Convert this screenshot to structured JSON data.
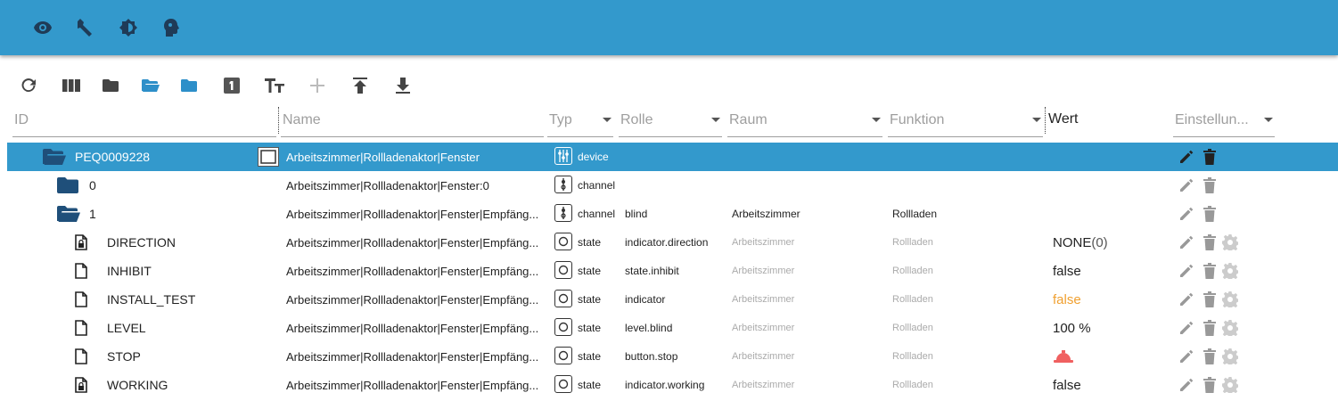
{
  "appbar": {
    "icons": [
      "eye-icon",
      "wrench-icon",
      "brightness-icon",
      "head-icon"
    ]
  },
  "toolbar": {
    "icons": [
      "refresh-icon",
      "columns-icon",
      "folder-closed-icon",
      "folder-open-icon",
      "folder-icon",
      "number-1-icon",
      "text-size-icon",
      "add-icon",
      "upload-icon",
      "download-icon"
    ]
  },
  "columns": {
    "id": "ID",
    "name": "Name",
    "type": "Typ",
    "role": "Rolle",
    "room": "Raum",
    "function": "Funktion",
    "value": "Wert",
    "settings": "Einstellun..."
  },
  "rows": [
    {
      "id": "PEQ0009228",
      "name": "Arbeitszimmer|Rollladenaktor|Fenster",
      "type": "device",
      "role": "",
      "room": "",
      "function": "",
      "value": "",
      "icon": "folder-open-icon"
    },
    {
      "id": "0",
      "name": "Arbeitszimmer|Rollladenaktor|Fenster:0",
      "type": "channel",
      "role": "",
      "room": "",
      "function": "",
      "value": "",
      "icon": "folder-icon"
    },
    {
      "id": "1",
      "name": "Arbeitszimmer|Rollladenaktor|Fenster|Empfäng...",
      "type": "channel",
      "role": "blind",
      "room": "Arbeitszimmer",
      "function": "Rollladen",
      "value": "",
      "icon": "folder-open-icon"
    },
    {
      "id": "DIRECTION",
      "name": "Arbeitszimmer|Rollladenaktor|Fenster|Empfäng...",
      "type": "state",
      "role": "indicator.direction",
      "room": "Arbeitszimmer",
      "function": "Rollladen",
      "value": "NONE",
      "value_suffix": "(0)",
      "icon": "file-lock-icon"
    },
    {
      "id": "INHIBIT",
      "name": "Arbeitszimmer|Rollladenaktor|Fenster|Empfäng...",
      "type": "state",
      "role": "state.inhibit",
      "room": "Arbeitszimmer",
      "function": "Rollladen",
      "value": "false",
      "icon": "file-icon"
    },
    {
      "id": "INSTALL_TEST",
      "name": "Arbeitszimmer|Rollladenaktor|Fenster|Empfäng...",
      "type": "state",
      "role": "indicator",
      "room": "Arbeitszimmer",
      "function": "Rollladen",
      "value": "false",
      "value_color": "#f0a030",
      "icon": "file-icon"
    },
    {
      "id": "LEVEL",
      "name": "Arbeitszimmer|Rollladenaktor|Fenster|Empfäng...",
      "type": "state",
      "role": "level.blind",
      "room": "Arbeitszimmer",
      "function": "Rollladen",
      "value": "100 %",
      "icon": "file-icon"
    },
    {
      "id": "STOP",
      "name": "Arbeitszimmer|Rollladenaktor|Fenster|Empfäng...",
      "type": "state",
      "role": "button.stop",
      "room": "Arbeitszimmer",
      "function": "Rollladen",
      "value": "",
      "icon": "file-icon"
    },
    {
      "id": "WORKING",
      "name": "Arbeitszimmer|Rollladenaktor|Fenster|Empfäng...",
      "type": "state",
      "role": "indicator.working",
      "room": "Arbeitszimmer",
      "function": "Rollladen",
      "value": "false",
      "icon": "file-lock-icon"
    }
  ],
  "colors": {
    "appbar": "#3399cc",
    "selected_row": "#3399cc",
    "folder": "#1f4f7a",
    "warning_value": "#f0a030",
    "stop_button": "#f06060"
  }
}
